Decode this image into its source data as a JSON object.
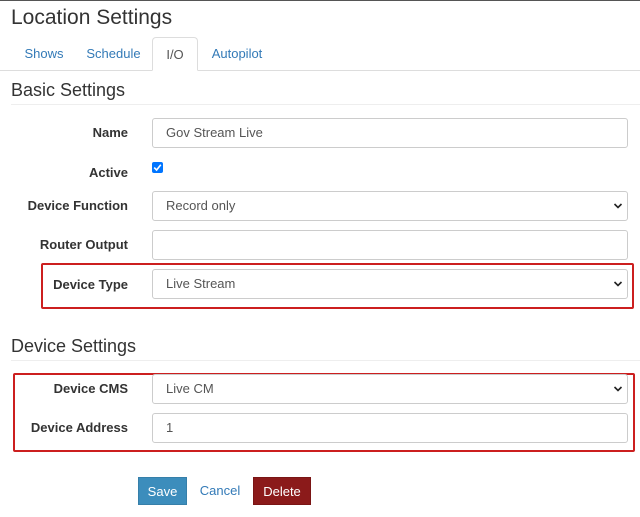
{
  "page": {
    "title": "Location Settings"
  },
  "tabs": [
    {
      "label": "Shows"
    },
    {
      "label": "Schedule"
    },
    {
      "label": "I/O"
    },
    {
      "label": "Autopilot"
    }
  ],
  "active_tab": "I/O",
  "basic_settings": {
    "title": "Basic Settings",
    "name": {
      "label": "Name",
      "value": "Gov Stream Live"
    },
    "active": {
      "label": "Active",
      "checked": true
    },
    "device_function": {
      "label": "Device Function",
      "value": "Record only"
    },
    "router_output": {
      "label": "Router Output",
      "value": ""
    },
    "device_type": {
      "label": "Device Type",
      "value": "Live Stream"
    }
  },
  "device_settings": {
    "title": "Device Settings",
    "device_cms": {
      "label": "Device CMS",
      "value": "Live CM"
    },
    "device_address": {
      "label": "Device Address",
      "value": "1"
    }
  },
  "actions": {
    "save_label": "Save",
    "cancel_label": "Cancel",
    "delete_label": "Delete"
  },
  "colors": {
    "link": "#337ab7",
    "save_button": "#3c8dbc",
    "delete_button": "#8b1a1a",
    "highlight": "#cc1f1f",
    "checkbox": "#0075ff"
  },
  "icons": {
    "select_indicator": "chevron-down-icon",
    "checkbox_mark": "checkmark-icon"
  }
}
